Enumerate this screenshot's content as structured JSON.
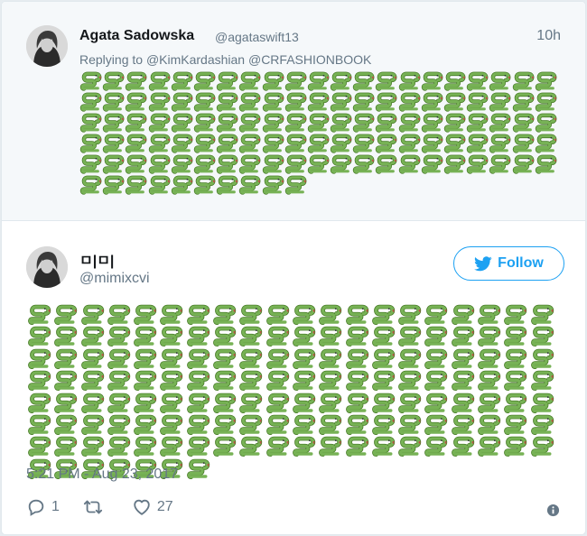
{
  "parent_tweet": {
    "author_name": "Agata Sadowska",
    "author_handle": "@agataswift13",
    "time": "10h",
    "replying_prefix": "Replying to",
    "replying_mentions": "@KimKardashian @CRFASHIONBOOK",
    "emoji": "snake",
    "emoji_count": 115
  },
  "tweet": {
    "author_name": "ㅁ|ㅁ|",
    "author_handle": "@mimixcvi",
    "follow_label": "Follow",
    "emoji": "snake",
    "emoji_count": 147,
    "timestamp": "5:21 PM - Aug 23, 2017",
    "reply_count": "1",
    "retweet_count": "",
    "like_count": "27"
  },
  "colors": {
    "accent": "#1da1f2",
    "muted": "#657786",
    "snake_green": "#77b255",
    "snake_dark": "#3e721d"
  },
  "icons": {
    "reply": "reply-icon",
    "retweet": "retweet-icon",
    "like": "heart-icon",
    "info": "info-icon",
    "follow": "bird-icon"
  }
}
